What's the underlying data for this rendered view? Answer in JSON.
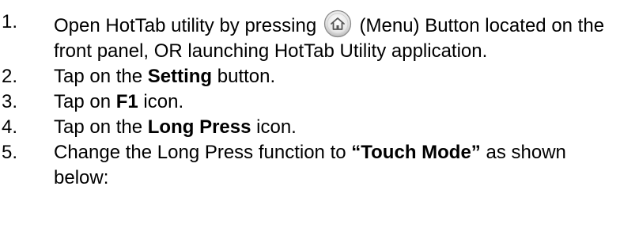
{
  "steps": [
    {
      "number": "1.",
      "before_icon": "Open HotTab utility by pressing ",
      "icon": "home-icon",
      "after_icon": " (Menu) Button located on the front panel, OR launching HotTab Utility application."
    },
    {
      "number": "2.",
      "pre": "Tap on the ",
      "bold": "Setting",
      "post": " button."
    },
    {
      "number": "3.",
      "pre": "Tap on ",
      "bold": "F1",
      "post": " icon."
    },
    {
      "number": "4.",
      "pre": "Tap on the ",
      "bold": "Long Press",
      "post": " icon."
    },
    {
      "number": "5.",
      "pre": "Change the Long Press function to ",
      "bold": "“Touch Mode”",
      "post": " as shown below:"
    }
  ]
}
